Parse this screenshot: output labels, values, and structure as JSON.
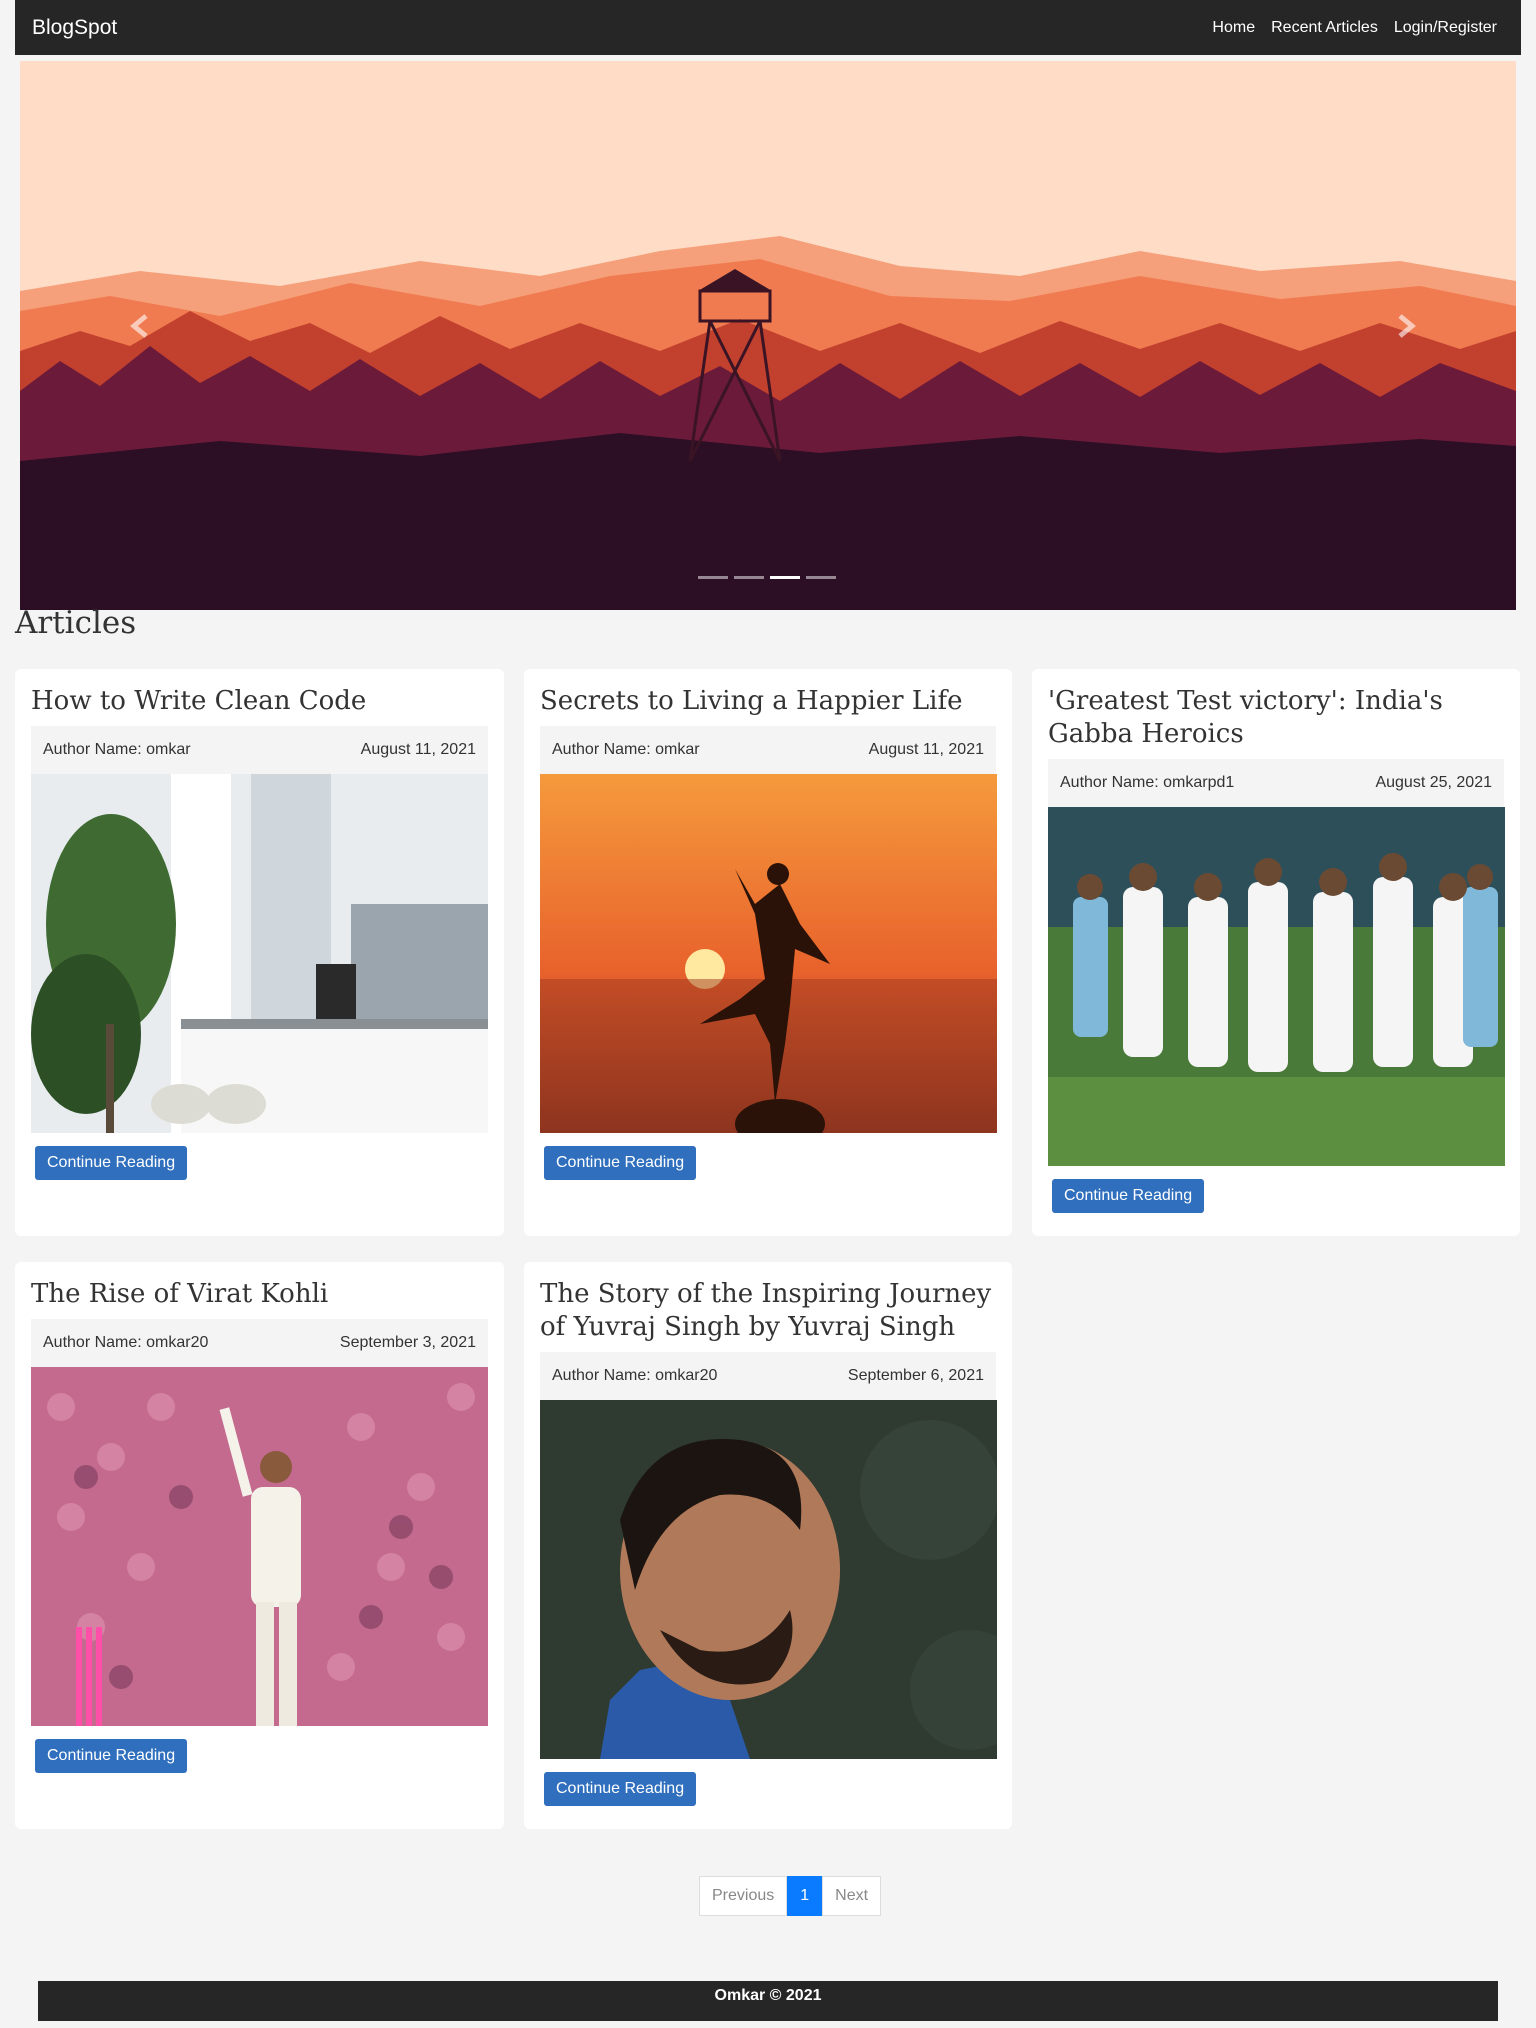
{
  "nav": {
    "brand": "BlogSpot",
    "links": [
      "Home",
      "Recent Articles",
      "Login/Register"
    ]
  },
  "hero": {
    "indicator_count": 4,
    "active_index": 2,
    "colors": {
      "sky": "#ffdcc6",
      "far": "#f07b50",
      "mid": "#c2402e",
      "near": "#6b1a3a",
      "ground": "#2c0f24"
    }
  },
  "articles_title": "Articles",
  "articles": [
    {
      "title": "How to Write Clean Code",
      "author": "Author Name: omkar",
      "date": "August 11, 2021",
      "button": "Continue Reading",
      "image": "office-photo"
    },
    {
      "title": "Secrets to Living a Happier Life",
      "author": "Author Name: omkar",
      "date": "August 11, 2021",
      "button": "Continue Reading",
      "image": "sunset-silhouette-photo"
    },
    {
      "title": "'Greatest Test victory': India's Gabba Heroics",
      "author": "Author Name: omkarpd1",
      "date": "August 25, 2021",
      "button": "Continue Reading",
      "image": "cricket-team-photo"
    },
    {
      "title": "The Rise of Virat Kohli",
      "author": "Author Name: omkar20",
      "date": "September 3, 2021",
      "button": "Continue Reading",
      "image": "batsman-celebrating-photo"
    },
    {
      "title": "The Story of the Inspiring Journey of Yuvraj Singh by Yuvraj Singh",
      "author": "Author Name: omkar20",
      "date": "September 6, 2021",
      "button": "Continue Reading",
      "image": "portrait-photo"
    }
  ],
  "pagination": {
    "previous": "Previous",
    "current": "1",
    "next": "Next"
  },
  "footer": "Omkar © 2021"
}
